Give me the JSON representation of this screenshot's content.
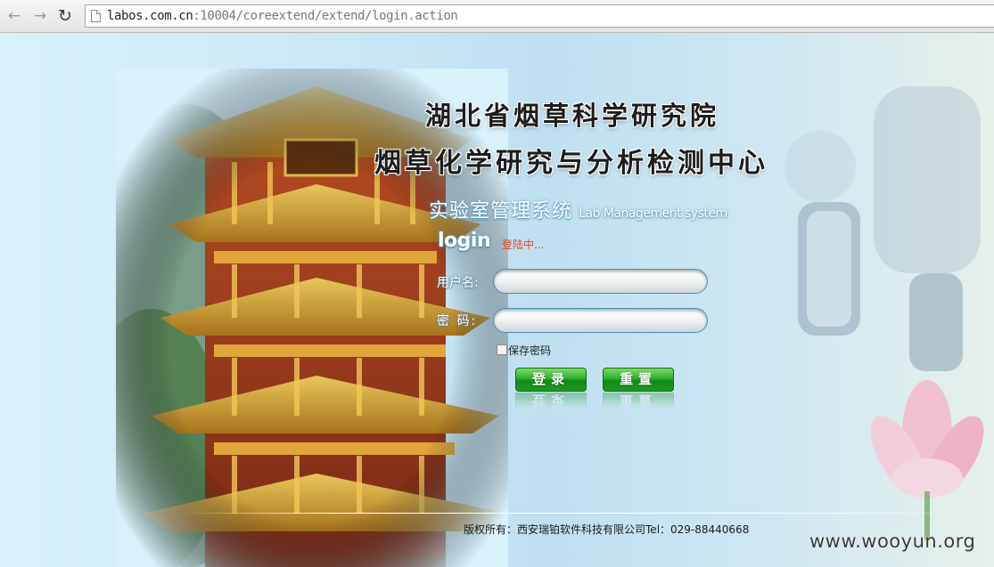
{
  "browser": {
    "url_host": "labos.com.cn",
    "url_path": ":10004/coreextend/extend/login.action",
    "back_icon": "back-arrow-icon",
    "forward_icon": "forward-arrow-icon",
    "reload_icon": "reload-icon"
  },
  "header": {
    "title_line1": "湖北省烟草科学研究院",
    "title_line2": "烟草化学研究与分析检测中心",
    "system_name_cn": "实验室管理系统",
    "system_name_en": "Lab Management system"
  },
  "login": {
    "heading": "login",
    "status": "登陆中...",
    "username_label": "用户名:",
    "password_label": "密  码:",
    "username_value": "",
    "password_value": "",
    "remember_label": "保存密码",
    "login_button": "登录",
    "reset_button": "重置"
  },
  "footer": {
    "copyright": "版权所有：西安瑞铂软件科技有限公司",
    "tel": "Tel：029-88440668"
  },
  "watermark": "www.wooyun.org",
  "colors": {
    "status": "#e8441c",
    "button_green": "#2fae2c",
    "field_border": "#4c8db5"
  }
}
